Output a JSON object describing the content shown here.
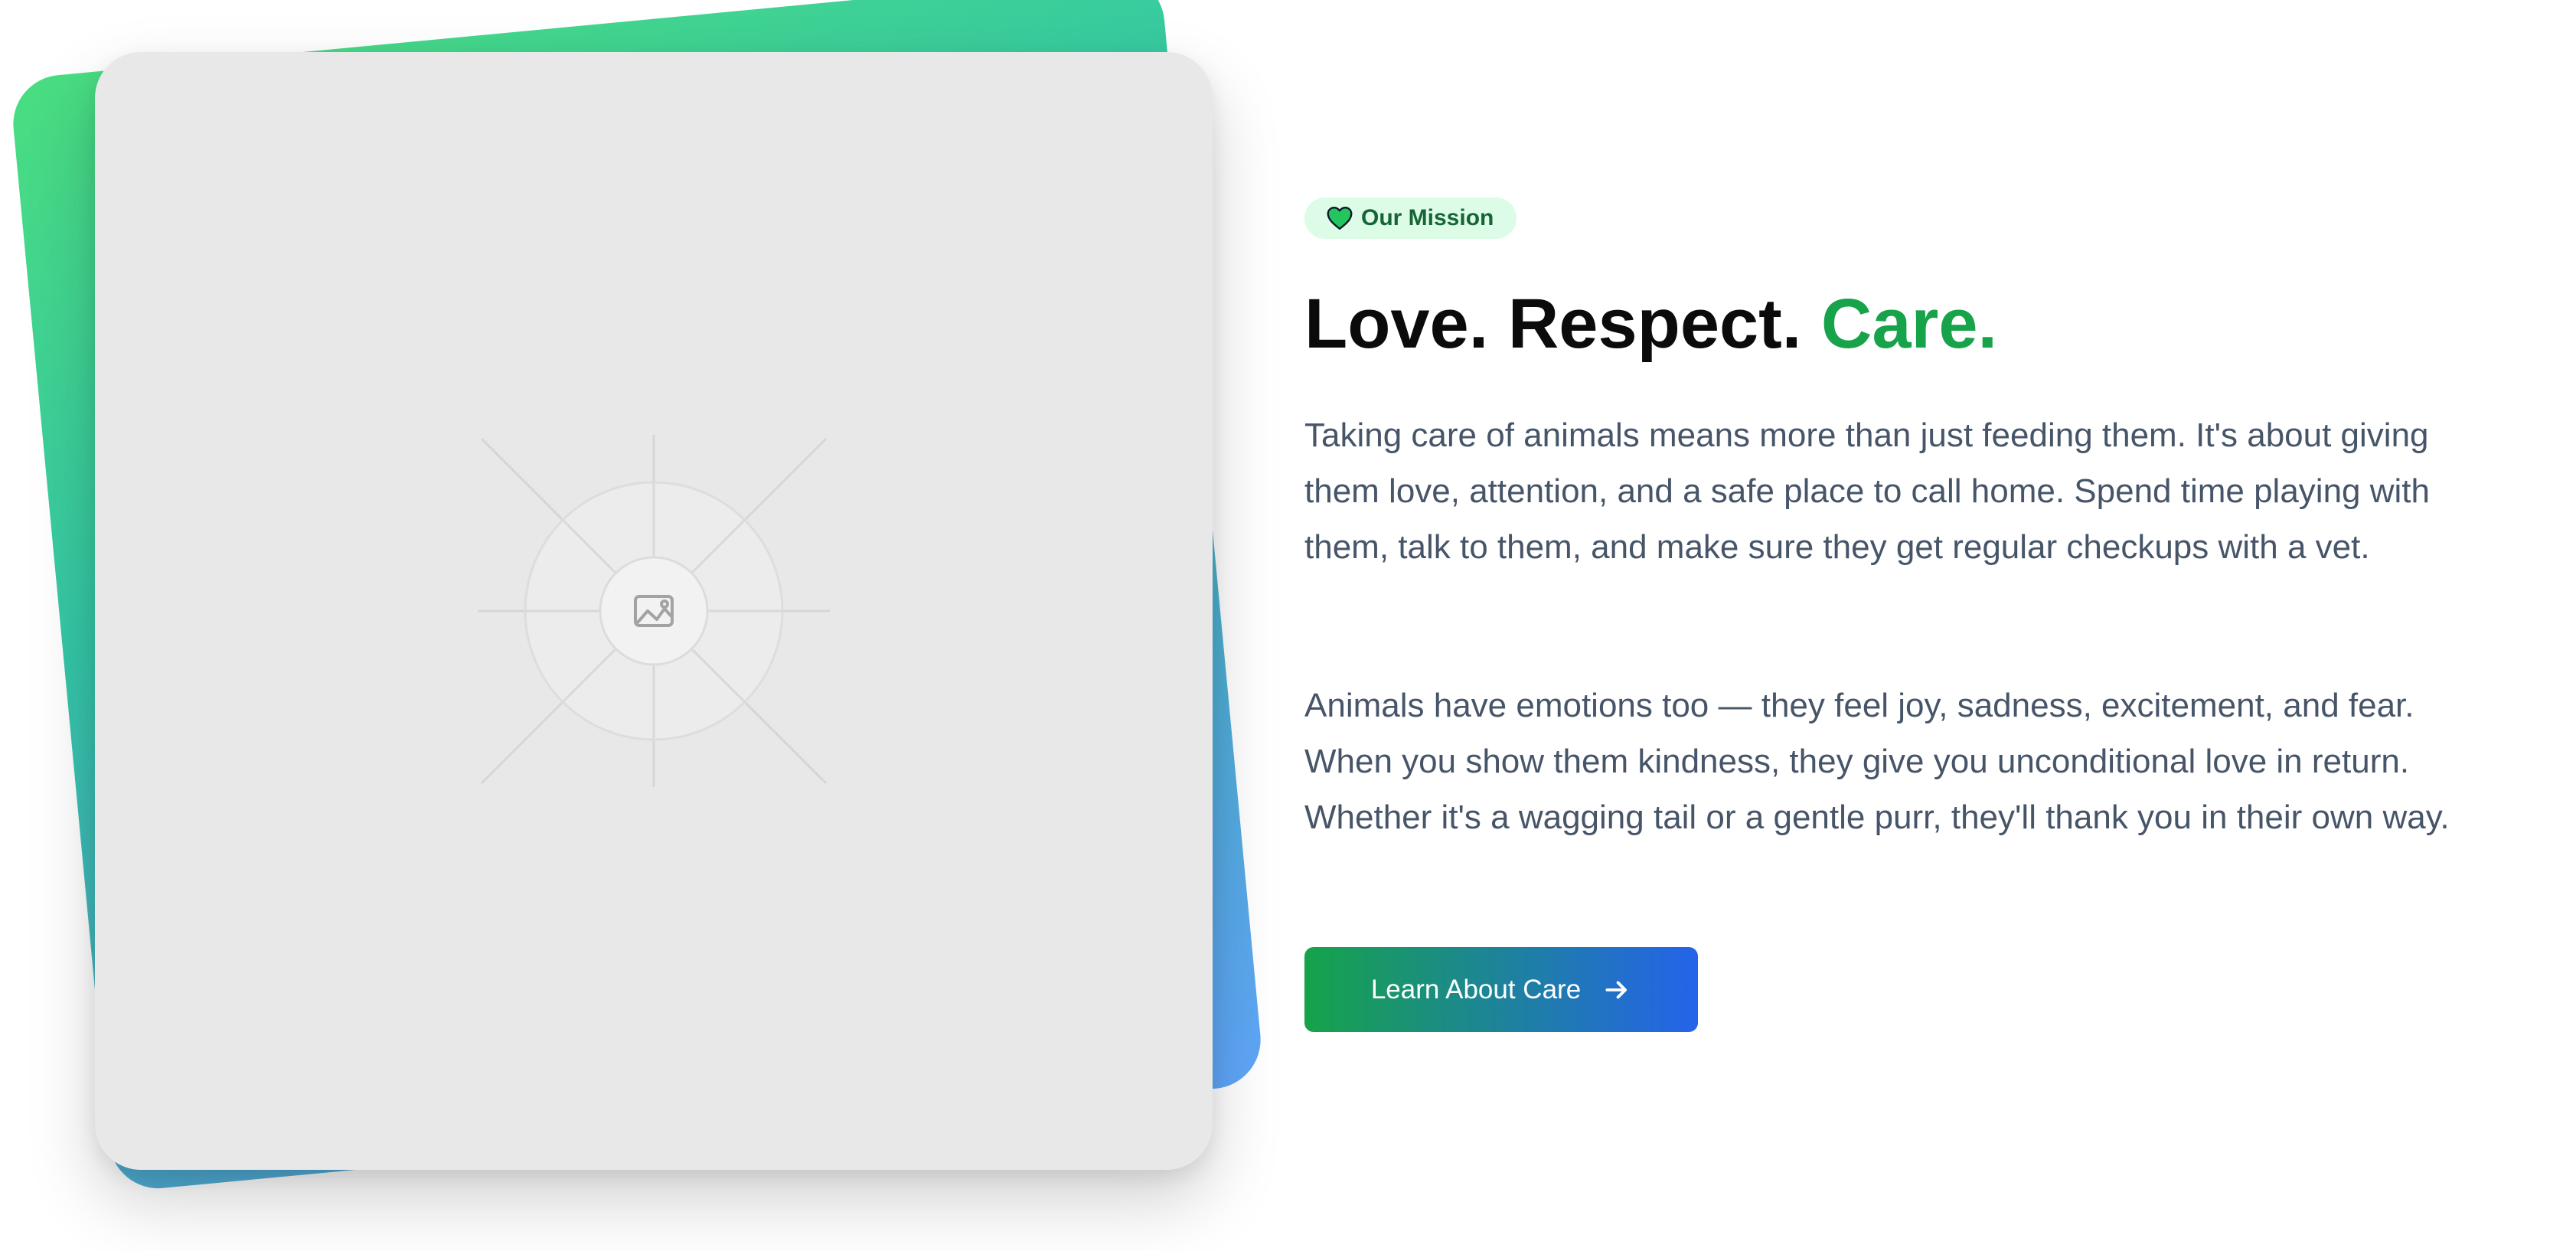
{
  "image_placeholder": {
    "icon": "image-icon"
  },
  "badge": {
    "icon": "heart-icon",
    "label": "Our Mission"
  },
  "heading": {
    "part1": "Love. Respect. ",
    "accent": "Care."
  },
  "paragraphs": [
    "Taking care of animals means more than just feeding them. It's about giving them love, attention, and a safe place to call home. Spend time playing with them, talk to them, and make sure they get regular checkups with a vet.",
    "Animals have emotions too — they feel joy, sadness, excitement, and fear. When you show them kindness, they give you unconditional love in return. Whether it's a wagging tail or a gentle purr, they'll thank you in their own way."
  ],
  "cta": {
    "label": "Learn About Care",
    "icon": "arrow-right-icon"
  },
  "colors": {
    "accent_green": "#16a34a",
    "accent_blue": "#2563eb",
    "badge_bg": "#dcfce7",
    "badge_text": "#166534",
    "heart_fill": "#22c55e",
    "body_text": "#475569",
    "card_bg": "#e8e8e8"
  }
}
